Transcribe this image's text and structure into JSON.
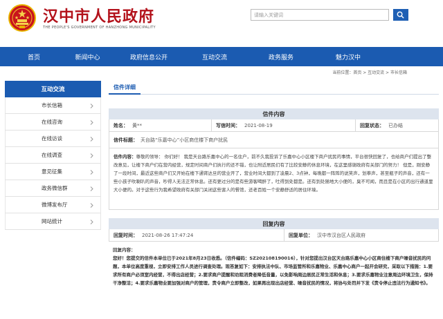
{
  "header": {
    "title": "汉中市人民政府",
    "subtitle": "THE PEOPLE'S GOVERNMENT OF HANZHONG MUNICIPALITY",
    "search_placeholder": "请输入关键词",
    "emblem_icon": "national-emblem-icon",
    "search_icon": "search-icon",
    "brand_color": "#b3121b",
    "nav_color": "#1b5bb1"
  },
  "nav": {
    "items": [
      "首页",
      "新闻中心",
      "政府信息公开",
      "互动交流",
      "政务服务",
      "魅力汉中"
    ]
  },
  "breadcrumb": "当前位置：首页 > 互动交流 > 市长信箱",
  "sidebar": {
    "heading": "互动交流",
    "items": [
      "市长信箱",
      "在线咨询",
      "在线访谈",
      "在线调查",
      "意见征集",
      "政务微信群",
      "微博发布厅",
      "网站统计"
    ]
  },
  "main": {
    "tab": "信件详细",
    "letter": {
      "section_title": "信件内容",
      "name_label": "姓名：",
      "name_value": "黄**",
      "date_label": "写信时间：",
      "date_value": "2021-08-19",
      "status_label": "回复状态：",
      "status_value": "已办结",
      "subject_label": "信件标题：",
      "subject_value": "天台路“乐嘉中心”小区商住楼下商户扰民",
      "content_label": "信件内容：",
      "content_value": "尊敬的领导： 你们好！ 我是天台路乐嘉中心的一名住户，前不久我投诉了乐嘉中心小区楼下商户扰民的事情，平台很快回复了，也给商户们提出了整改意见，让楼下商户们在营内经营，规定时间商户们执行的还不错，也让附近居民们有了比较安静的休息环境，在这里感谢政府有关部门的努力！ 但是，刚安静了一段时间，最近这些商户们又开始在楼下通宵达旦的营业开了，营业时间大都到了凌晨2、3点钟，每晚都一阵阵的说笑声，划拳声，甚至瓶子的声音，还有一些小孩子吹喇叭的声音，吵得人无法正常休息。还有更过分的是有些游客喝醉了，吐得到处都是。还有到处随地大小便的，臭不可闻，而且是在小区的出行通道里大小便的。对于这些行为我希望政府有关部门关闭这些害人的餐馆，还老百姓一个安静舒适的居住环境。"
    },
    "reply": {
      "section_title": "回复内容",
      "date_label": "回复时间：",
      "date_value": "2021-08-26 17:47:24",
      "unit_label": "回复单位：",
      "unit_value": "汉中市汉台区人民政府",
      "content_label": "回复内容：",
      "greeting": "您好！您提交的信件本单位已于2021年8月23日收悉。",
      "body": "（信件编码：SZ202108190016），针对您提出汉台区天台路乐嘉中心小区商住楼下商户噪音扰民的问题，本单位高度重视，立即安排工作人员进行调查处理。现答复如下：安排执法中队、市场监管所和乐嘉物业、乐嘉中心商户一起开会研究，采取以下措施：1.要求所有商户必须室内经营，不得出店经营；2.要求商户提醒和劝阻消费者降低音量，以免影响周边居民正常生活和休息；3.要求乐嘉物业注意周边环境卫生，保持干净整洁；4.要求乐嘉物业要加强对商户的管理，责令商户立即整改，如果再出现出店经营、噪音扰民的情况，将协与处罚并下发《责令停止违法行为通知书》。"
    }
  }
}
